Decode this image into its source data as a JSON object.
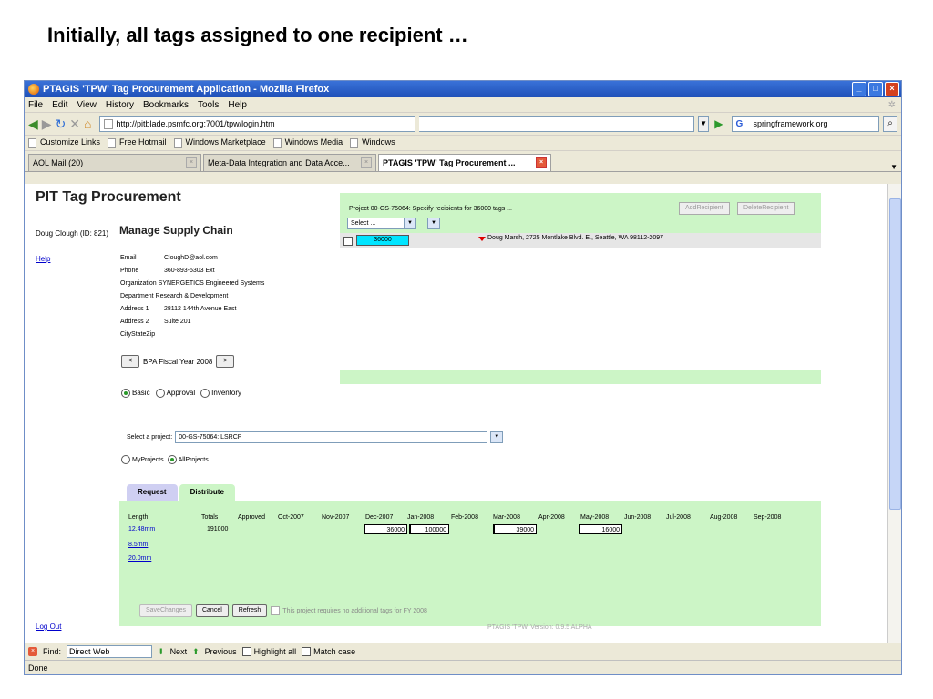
{
  "slide_title": "Initially, all tags assigned to one recipient …",
  "window": {
    "title": "PTAGIS 'TPW' Tag Procurement Application - Mozilla Firefox",
    "menu": [
      "File",
      "Edit",
      "View",
      "History",
      "Bookmarks",
      "Tools",
      "Help"
    ],
    "url": "http://pitblade.psmfc.org:7001/tpw/login.htm",
    "search": "springframework.org",
    "bookmarks": [
      "Customize Links",
      "Free Hotmail",
      "Windows Marketplace",
      "Windows Media",
      "Windows"
    ],
    "tabs": [
      "AOL Mail (20)",
      "Meta-Data Integration and Data Acce...",
      "PTAGIS 'TPW' Tag Procurement ..."
    ],
    "find": {
      "label": "Find:",
      "value": "Direct Web",
      "next": "Next",
      "previous": "Previous",
      "highlight": "Highlight all",
      "match_case": "Match case"
    },
    "status": "Done"
  },
  "page": {
    "title": "PIT Tag Procurement",
    "user": "Doug Clough (ID: 821)",
    "help": "Help",
    "logout": "Log Out",
    "section_title": "Manage Supply Chain",
    "info": [
      {
        "label": "Email",
        "value": "CloughD@aol.com"
      },
      {
        "label": "Phone",
        "value": "360-893-5303 Ext"
      },
      {
        "label": "Organization",
        "value": "SYNERGETICS Engineered Systems"
      },
      {
        "label": "Department",
        "value": "Research & Development"
      },
      {
        "label": "Address 1",
        "value": "28112 144th Avenue East"
      },
      {
        "label": "Address 2",
        "value": "Suite 201"
      },
      {
        "label": "CityStateZip",
        "value": ""
      }
    ],
    "fiscal_year": "BPA Fiscal Year 2008",
    "fy_prev": "<",
    "fy_next": ">",
    "modes": [
      "Basic",
      "Approval",
      "Inventory"
    ],
    "project_label": "Select a project:",
    "project_value": "00-GS-75064: LSRCP",
    "project_filters": [
      "MyProjects",
      "AllProjects"
    ],
    "recipients": {
      "header": "Project 00-GS-75064: Specify recipients for 36000 tags ...",
      "select": "Select ...",
      "add": "AddRecipient",
      "delete": "DeleteRecipient",
      "row_count": "36000",
      "row_recipient": "Doug Marsh, 2725 Montlake Blvd. E., Seattle, WA 98112-2097"
    },
    "tabs": [
      "Request",
      "Distribute"
    ],
    "distribute": {
      "headers": [
        "Length",
        "Totals",
        "Approved",
        "Oct-2007",
        "Nov-2007",
        "Dec-2007",
        "Jan-2008",
        "Feb-2008",
        "Mar-2008",
        "Apr-2008",
        "May-2008",
        "Jun-2008",
        "Jul-2008",
        "Aug-2008",
        "Sep-2008"
      ],
      "lengths": [
        "12.48mm",
        "8.5mm",
        "20.0mm"
      ],
      "total": "191000",
      "cells": [
        "36000",
        "100000",
        "39000",
        "16000"
      ],
      "save": "SaveChanges",
      "cancel": "Cancel",
      "refresh": "Refresh",
      "note": "This project requires no additional tags for FY 2008"
    },
    "version": "PTAGIS 'TPW' Version: 0.9.5 ALPHA"
  }
}
